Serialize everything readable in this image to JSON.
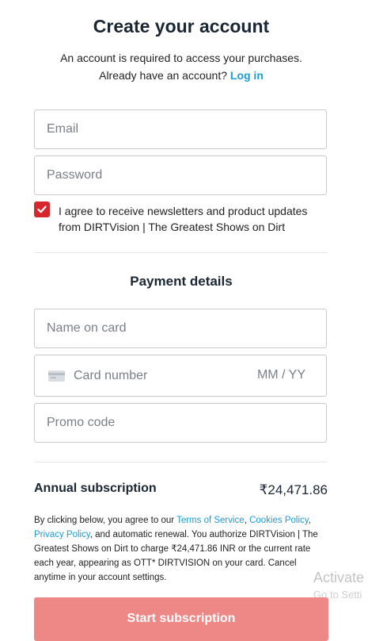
{
  "header": {
    "title": "Create your account",
    "subtitle": "An account is required to access your purchases.",
    "login_prompt": "Already have an account?",
    "login_link": "Log in"
  },
  "account_form": {
    "email_placeholder": "Email",
    "password_placeholder": "Password",
    "newsletter_checked": true,
    "newsletter_line1": "I agree to receive newsletters and product updates",
    "newsletter_line2": "from DIRTVision | The Greatest Shows on Dirt"
  },
  "payment": {
    "title": "Payment details",
    "name_placeholder": "Name on card",
    "card_placeholder": "Card number",
    "expiry_placeholder": "MM / YY",
    "promo_placeholder": "Promo code"
  },
  "summary": {
    "plan_label": "Annual subscription",
    "plan_price": "₹24,471.86"
  },
  "legal": {
    "text1": "By clicking below, you agree to our ",
    "terms_link": "Terms of Service",
    "comma1": ", ",
    "cookies_link": "Cookies Policy",
    "comma2": ",",
    "privacy_link": "Privacy Policy",
    "text2": ", and automatic renewal. You authorize DIRTVision | The Greatest Shows on Dirt to charge ₹24,471.86 INR or the current rate each year, appearing as OTT* DIRTVISION on your card. Cancel anytime in your account settings."
  },
  "actions": {
    "start_label": "Start subscription"
  },
  "overlay": {
    "activate_line1": "Activate",
    "activate_line2": "Go to Setti"
  },
  "colors": {
    "accent_link": "#1e9bd7",
    "checkbox": "#d9262c",
    "start_button": "#ee8886"
  }
}
